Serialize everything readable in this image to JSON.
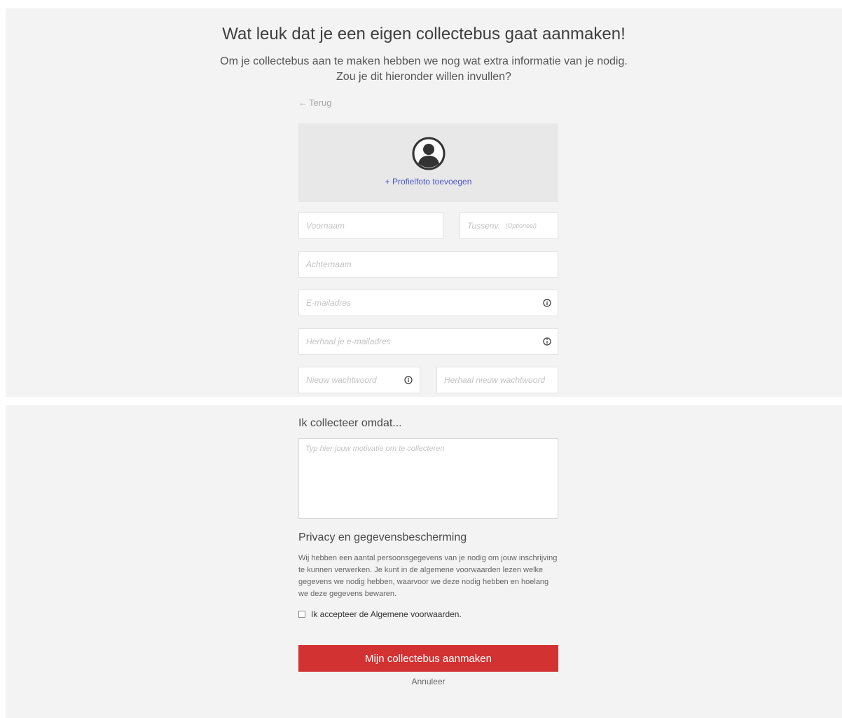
{
  "header": {
    "title": "Wat leuk dat je een eigen collectebus gaat aanmaken!",
    "subtitle_line1": "Om je collectebus aan te maken hebben we nog wat extra informatie van je nodig.",
    "subtitle_line2": "Zou je dit hieronder willen invullen?"
  },
  "nav": {
    "back_label": "Terug"
  },
  "profile_photo": {
    "add_label": "+ Profielfoto toevoegen"
  },
  "form": {
    "first_name": {
      "placeholder": "Voornaam",
      "value": ""
    },
    "infix": {
      "placeholder": "Tussenv.",
      "value": "",
      "optional_label": "(Optioneel)"
    },
    "last_name": {
      "placeholder": "Achternaam",
      "value": ""
    },
    "email": {
      "placeholder": "E-mailadres",
      "value": ""
    },
    "email_repeat": {
      "placeholder": "Herhaal je e-mailadres",
      "value": ""
    },
    "password": {
      "placeholder": "Nieuw wachtwoord",
      "value": ""
    },
    "password_repeat": {
      "placeholder": "Herhaal nieuw wachtwoord",
      "value": ""
    }
  },
  "motivation": {
    "heading": "Ik collecteer omdat...",
    "placeholder": "Typ hier jouw motivatie om te collecteren"
  },
  "privacy": {
    "heading": "Privacy en gegevensbescherming",
    "text": "Wij hebben een aantal persoonsgegevens van je nodig om jouw inschrijving te kunnen verwerken. Je kunt in de algemene voorwaarden lezen welke gegevens we nodig hebben, waarvoor we deze nodig hebben en hoelang we deze gegevens bewaren.",
    "accept_label": "Ik accepteer de Algemene voorwaarden.",
    "accept_checked": false
  },
  "actions": {
    "submit_label": "Mijn collectebus aanmaken",
    "cancel_label": "Annuleer"
  },
  "colors": {
    "primary_button": "#d23232",
    "link": "#4a56c9",
    "panel_bg": "#f3f3f3"
  }
}
